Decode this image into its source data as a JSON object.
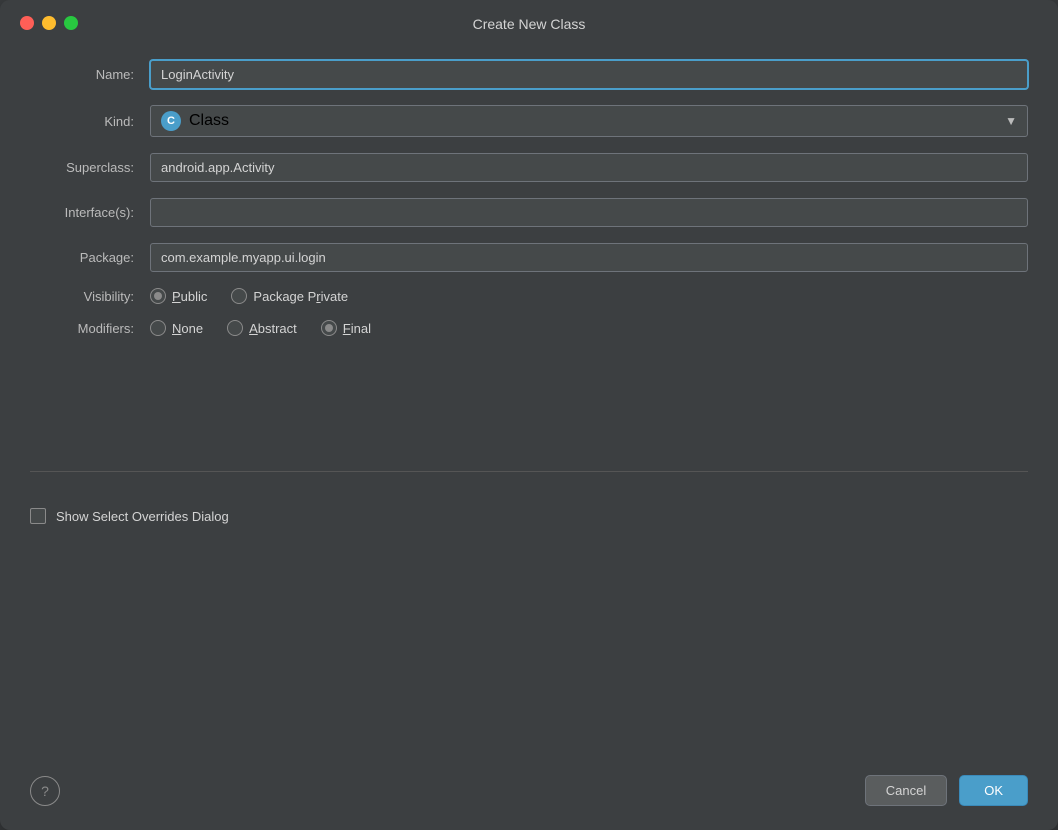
{
  "window": {
    "title": "Create New Class"
  },
  "form": {
    "name_label": "Name:",
    "name_value": "LoginActivity",
    "kind_label": "Kind:",
    "kind_value": "Class",
    "kind_icon": "C",
    "superclass_label": "Superclass:",
    "superclass_value": "android.app.Activity",
    "interfaces_label": "Interface(s):",
    "interfaces_value": "",
    "package_label": "Package:",
    "package_value": "com.example.myapp.ui.login",
    "visibility_label": "Visibility:",
    "modifiers_label": "Modifiers:"
  },
  "visibility": {
    "options": [
      {
        "id": "public",
        "label": "Public",
        "underline": "u",
        "checked": true
      },
      {
        "id": "package_private",
        "label": "Package Private",
        "underline": "r",
        "checked": false
      }
    ]
  },
  "modifiers": {
    "options": [
      {
        "id": "none",
        "label": "None",
        "underline": "N",
        "checked": false
      },
      {
        "id": "abstract",
        "label": "Abstract",
        "underline": "A",
        "checked": false
      },
      {
        "id": "final",
        "label": "Final",
        "underline": "F",
        "checked": true
      }
    ]
  },
  "checkbox": {
    "label": "Show Select Overrides Dialog",
    "checked": false
  },
  "buttons": {
    "help": "?",
    "cancel": "Cancel",
    "ok": "OK"
  }
}
